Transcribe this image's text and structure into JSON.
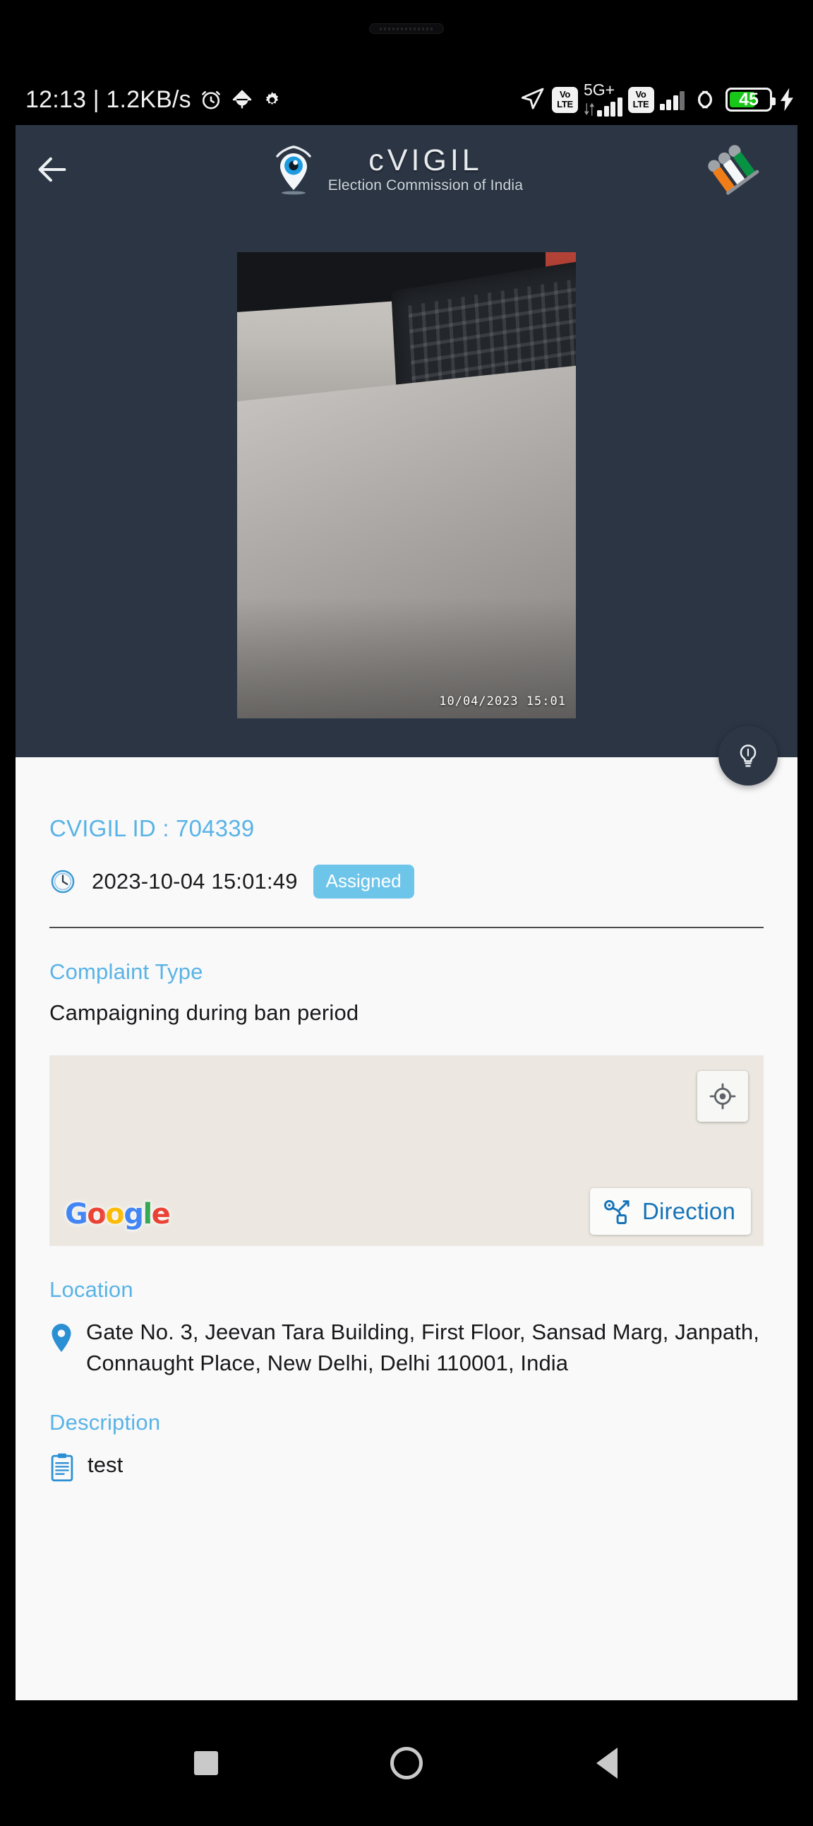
{
  "status_bar": {
    "clock_and_rate": "12:13 | 1.2KB/s",
    "icons_left": [
      "alarm-icon",
      "bug-icon",
      "gear-icon"
    ],
    "icons_right": [
      "navigation-arrow-icon",
      "volte-badge",
      "5g-plus-signal",
      "volte-badge-2",
      "signal-bars-2",
      "dual-sim-icon",
      "battery-icon",
      "charging-bolt-icon"
    ],
    "network_label": "5G+",
    "volte_line1": "Vo",
    "volte_line2": "LTE",
    "battery_percent": "45",
    "battery_color": "#18c718"
  },
  "app_bar": {
    "back_icon": "arrow-left-icon",
    "logo_icon": "cvigil-eye-pin-logo",
    "title": "cVIGIL",
    "subtitle": "Election Commission of India",
    "eci_logo_icon": "eci-tricolour-logo",
    "background_color": "#2b3544"
  },
  "media": {
    "type": "photo-evidence",
    "timestamp_overlay": "10/04/2023  15:01",
    "bulb_fab_icon": "lightbulb-icon"
  },
  "details": {
    "cvigil_id_label": "CVIGIL ID : 704339",
    "clock_icon": "clock-icon",
    "submitted_at": "2023-10-04 15:01:49",
    "status_badge": "Assigned",
    "status_badge_color": "#6ec5ea",
    "accent_color": "#59b3e6",
    "complaint_type_label": "Complaint Type",
    "complaint_type_value": "Campaigning during ban period",
    "location_label": "Location",
    "location_icon": "map-pin-icon",
    "location_value": "Gate No. 3, Jeevan Tara Building, First Floor, Sansad Marg, Janpath, Connaught Place, New Delhi, Delhi 110001, India",
    "description_label": "Description",
    "description_icon": "clipboard-icon",
    "description_value": "test"
  },
  "map": {
    "background_color": "#ece8e1",
    "recenter_icon": "crosshair-icon",
    "watermark_letters": [
      "G",
      "o",
      "o",
      "g",
      "l",
      "e"
    ],
    "direction_icon": "directions-route-icon",
    "direction_label": "Direction"
  },
  "nav_bar": {
    "recents_icon": "square-icon",
    "home_icon": "circle-icon",
    "back_icon": "triangle-back-icon"
  }
}
